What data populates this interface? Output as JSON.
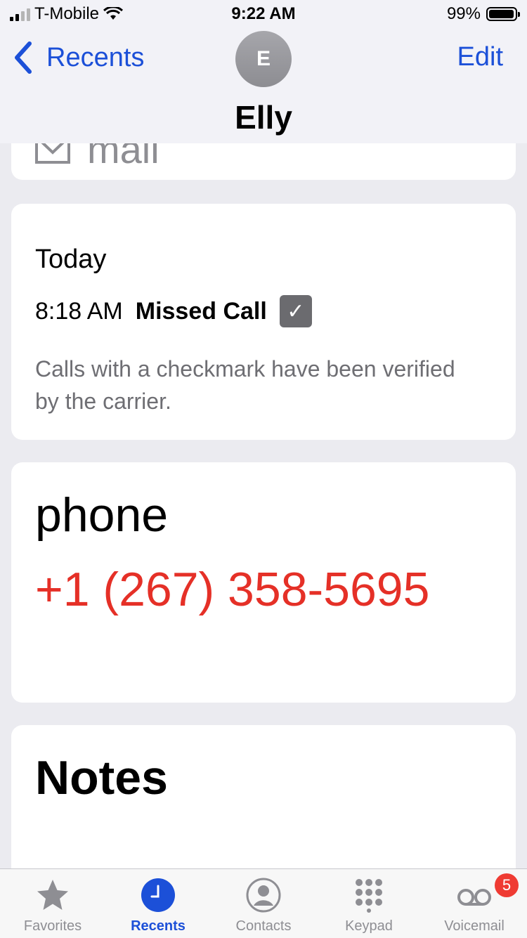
{
  "status": {
    "carrier": "T-Mobile",
    "time": "9:22 AM",
    "battery": "99%"
  },
  "nav": {
    "back_label": "Recents",
    "edit_label": "Edit",
    "avatar_initial": "E",
    "contact_name": "Elly"
  },
  "mail_card": {
    "label": "mail"
  },
  "call_card": {
    "day": "Today",
    "time": "8:18 AM",
    "type": "Missed Call",
    "verified_note": "Calls with a checkmark have been verified by the carrier."
  },
  "phone_card": {
    "label": "phone",
    "number": "+1 (267) 358-5695"
  },
  "notes_card": {
    "label": "Notes"
  },
  "tabs": [
    {
      "label": "Favorites",
      "icon": "star-icon"
    },
    {
      "label": "Recents",
      "icon": "clock-icon"
    },
    {
      "label": "Contacts",
      "icon": "person-circle-icon"
    },
    {
      "label": "Keypad",
      "icon": "keypad-icon"
    },
    {
      "label": "Voicemail",
      "icon": "voicemail-icon",
      "badge": "5"
    }
  ],
  "colors": {
    "accent": "#1c50d8",
    "phone_number": "#e53027",
    "badge": "#ef3b33"
  }
}
